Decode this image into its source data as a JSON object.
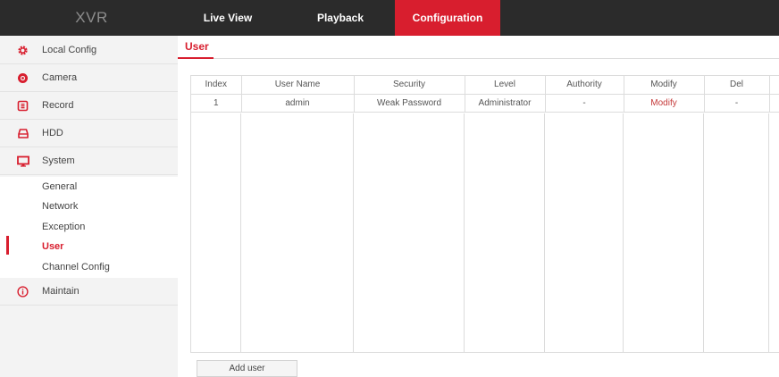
{
  "app": {
    "logo": "XVR"
  },
  "nav": {
    "tabs": [
      {
        "label": "Live View"
      },
      {
        "label": "Playback"
      },
      {
        "label": "Configuration",
        "active": true
      }
    ],
    "active_color": "#d81e2e"
  },
  "sidebar": {
    "items": [
      {
        "label": "Local Config",
        "icon": "gear-icon"
      },
      {
        "label": "Camera",
        "icon": "camera-icon"
      },
      {
        "label": "Record",
        "icon": "record-icon"
      },
      {
        "label": "HDD",
        "icon": "hdd-icon"
      },
      {
        "label": "System",
        "icon": "monitor-icon"
      },
      {
        "label": "Maintain",
        "icon": "info-icon"
      }
    ],
    "system_sub": [
      {
        "label": "General"
      },
      {
        "label": "Network"
      },
      {
        "label": "Exception"
      },
      {
        "label": "User",
        "active": true
      },
      {
        "label": "Channel Config"
      }
    ]
  },
  "main": {
    "title": "User",
    "table": {
      "columns": [
        "Index",
        "User Name",
        "Security",
        "Level",
        "Authority",
        "Modify",
        "Del"
      ],
      "rows": [
        [
          "1",
          "admin",
          "Weak Password",
          "Administrator",
          "-",
          "Modify",
          "-"
        ]
      ]
    },
    "add_button": "Add user"
  },
  "colors": {
    "accent": "#d81e2e",
    "topbar": "#2b2b2b"
  }
}
